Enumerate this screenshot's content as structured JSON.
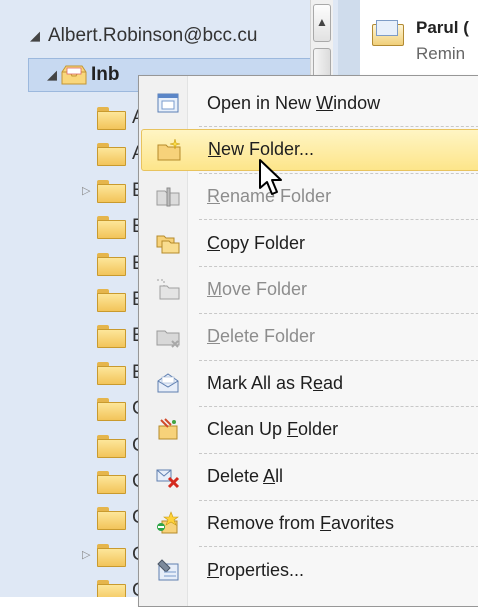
{
  "folder_pane": {
    "account": "Albert.Robinson@bcc.cu",
    "inbox": "Inb",
    "folders": [
      {
        "label": "A",
        "expandable": false
      },
      {
        "label": "A",
        "expandable": false
      },
      {
        "label": "E",
        "expandable": true
      },
      {
        "label": "E",
        "expandable": false
      },
      {
        "label": "E",
        "expandable": false
      },
      {
        "label": "E",
        "expandable": false
      },
      {
        "label": "E",
        "expandable": false
      },
      {
        "label": "E",
        "expandable": false
      },
      {
        "label": "C",
        "expandable": false
      },
      {
        "label": "C",
        "expandable": false
      },
      {
        "label": "C",
        "expandable": false
      },
      {
        "label": "C",
        "expandable": false
      },
      {
        "label": "C",
        "expandable": true
      },
      {
        "label": "C",
        "expandable": false
      }
    ]
  },
  "message_list": {
    "sender": "Parul (",
    "subject": "Remin"
  },
  "context_menu": {
    "items": [
      {
        "pre": "Open in New ",
        "key": "W",
        "post": "indow",
        "icon": "open-window-icon",
        "disabled": false
      },
      {
        "pre": "",
        "key": "N",
        "post": "ew Folder...",
        "icon": "new-folder-icon",
        "disabled": false,
        "highlighted": true
      },
      {
        "pre": "",
        "key": "R",
        "post": "ename Folder",
        "icon": "rename-folder-icon",
        "disabled": true
      },
      {
        "pre": "",
        "key": "C",
        "post": "opy Folder",
        "icon": "copy-folder-icon",
        "disabled": false
      },
      {
        "pre": "",
        "key": "M",
        "post": "ove Folder",
        "icon": "move-folder-icon",
        "disabled": true
      },
      {
        "pre": "",
        "key": "D",
        "post": "elete Folder",
        "icon": "delete-folder-icon",
        "disabled": true
      },
      {
        "pre": "Mark All as R",
        "key": "e",
        "post": "ad",
        "icon": "mark-read-icon",
        "disabled": false
      },
      {
        "pre": "Clean Up ",
        "key": "F",
        "post": "older",
        "icon": "clean-up-icon",
        "disabled": false
      },
      {
        "pre": "Delete ",
        "key": "A",
        "post": "ll",
        "icon": "delete-all-icon",
        "disabled": false
      },
      {
        "pre": "Remove from ",
        "key": "F",
        "post": "avorites",
        "icon": "remove-favorites-icon",
        "disabled": false
      },
      {
        "pre": "",
        "key": "P",
        "post": "roperties...",
        "icon": "properties-icon",
        "disabled": false
      }
    ]
  },
  "colors": {
    "highlight": "#fde58a",
    "pane_bg": "#dfe8f5",
    "disabled_text": "#8d8d8d"
  }
}
